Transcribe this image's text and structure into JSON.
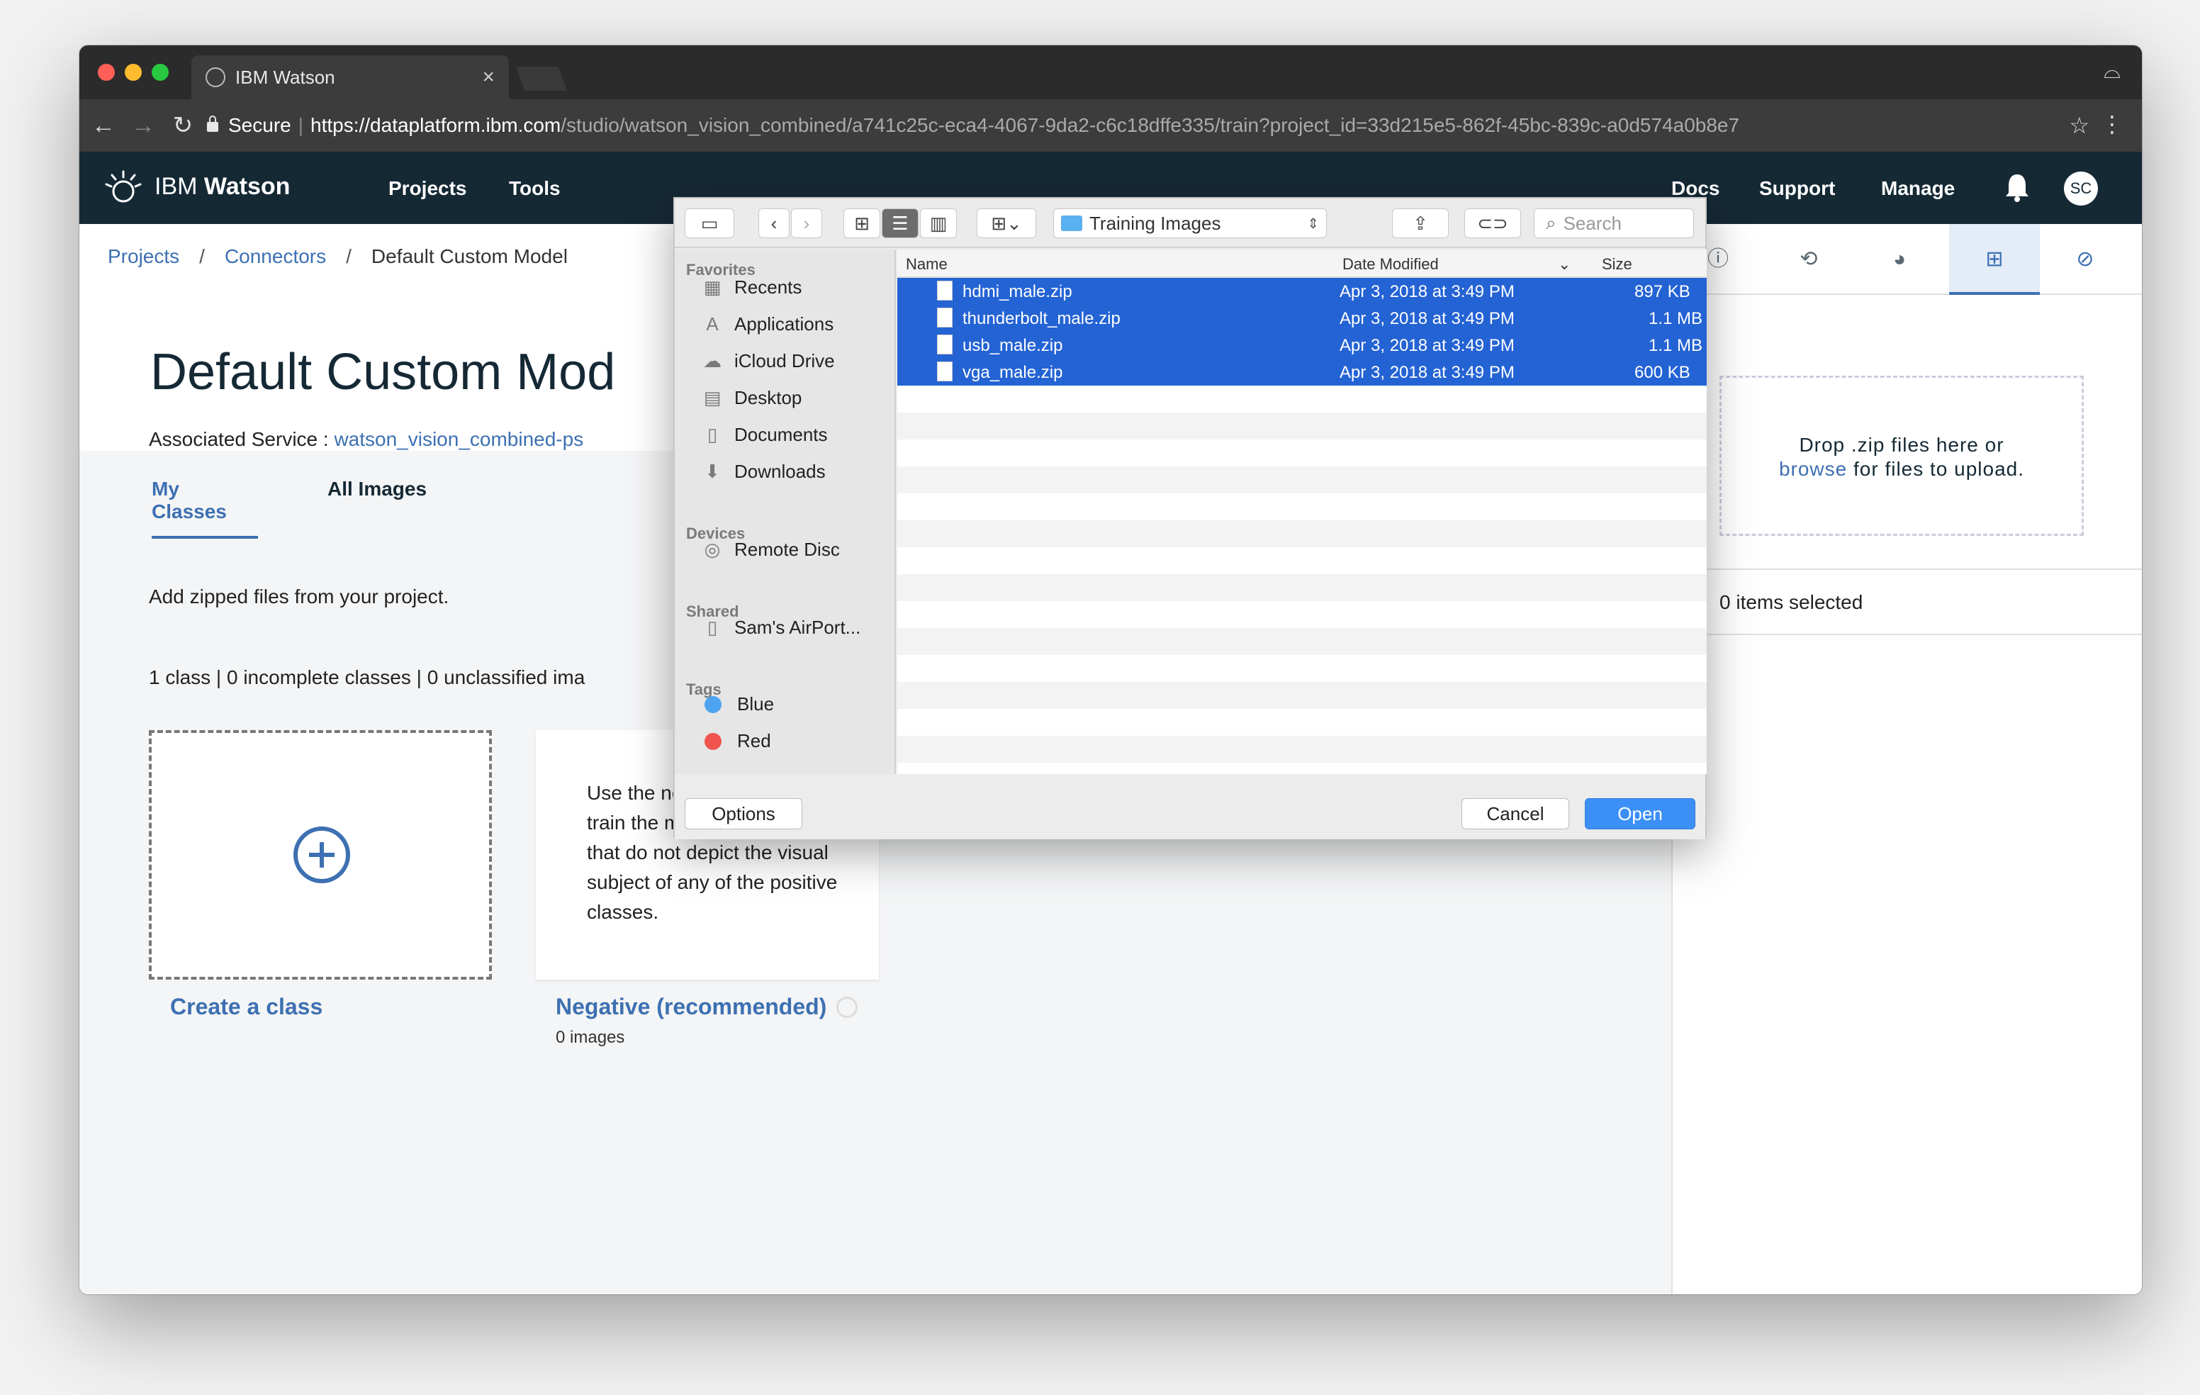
{
  "browser": {
    "tab_title": "IBM Watson",
    "tab_close": "×",
    "secure_label": "Secure",
    "url_scheme": "https://",
    "url_host": "dataplatform.ibm.com",
    "url_path": "/studio/watson_vision_combined/a741c25c-eca4-4067-9da2-c6c18dffe335/train?project_id=33d215e5-862f-45bc-839c-a0d574a0b8e7"
  },
  "header": {
    "brand_ibm": "IBM",
    "brand_watson": "Watson",
    "nav": [
      "Projects",
      "Tools",
      "Docs",
      "Support",
      "Manage"
    ],
    "avatar_initials": "SC"
  },
  "breadcrumb": {
    "items": [
      "Projects",
      "Connectors",
      "Default Custom Model"
    ],
    "separator": "/"
  },
  "page": {
    "title": "Default Custom Mod",
    "assoc_label": "Associated Service : ",
    "assoc_service": "watson_vision_combined-ps",
    "tabs": [
      "My Classes",
      "All Images"
    ],
    "add_zip_text": "Add zipped files from your project.",
    "counts_text": "1 class | 0 incomplete classes | 0 unclassified ima",
    "create_class_label": "Create a class",
    "negative_desc": "Use the negative class to train the model on images that do not depict the visual subject of any of the positive classes.",
    "negative_label": "Negative (recommended)",
    "negative_count": "0 images"
  },
  "right_panel": {
    "drop_text_1": "Drop .zip files here or",
    "drop_browse": "browse",
    "drop_text_2": " for files to upload.",
    "items_selected": "0 items selected"
  },
  "dialog": {
    "location": "Training Images",
    "search_placeholder": "Search",
    "sidebar": {
      "favorites_title": "Favorites",
      "favorites": [
        "Recents",
        "Applications",
        "iCloud Drive",
        "Desktop",
        "Documents",
        "Downloads"
      ],
      "devices_title": "Devices",
      "devices": [
        "Remote Disc"
      ],
      "shared_title": "Shared",
      "shared": [
        "Sam's AirPort..."
      ],
      "tags_title": "Tags",
      "tags": [
        {
          "name": "Blue",
          "color": "#4da3f0"
        },
        {
          "name": "Red",
          "color": "#f0544f"
        }
      ]
    },
    "columns": {
      "name": "Name",
      "date": "Date Modified",
      "size": "Size"
    },
    "files": [
      {
        "name": "hdmi_male.zip",
        "date": "Apr 3, 2018 at 3:49 PM",
        "size": "897 KB"
      },
      {
        "name": "thunderbolt_male.zip",
        "date": "Apr 3, 2018 at 3:49 PM",
        "size": "1.1 MB"
      },
      {
        "name": "usb_male.zip",
        "date": "Apr 3, 2018 at 3:49 PM",
        "size": "1.1 MB"
      },
      {
        "name": "vga_male.zip",
        "date": "Apr 3, 2018 at 3:49 PM",
        "size": "600 KB"
      }
    ],
    "options_label": "Options",
    "cancel_label": "Cancel",
    "open_label": "Open"
  },
  "colors": {
    "ibm_header": "#152935",
    "accent": "#3d70b2",
    "selection": "#2463d4"
  }
}
